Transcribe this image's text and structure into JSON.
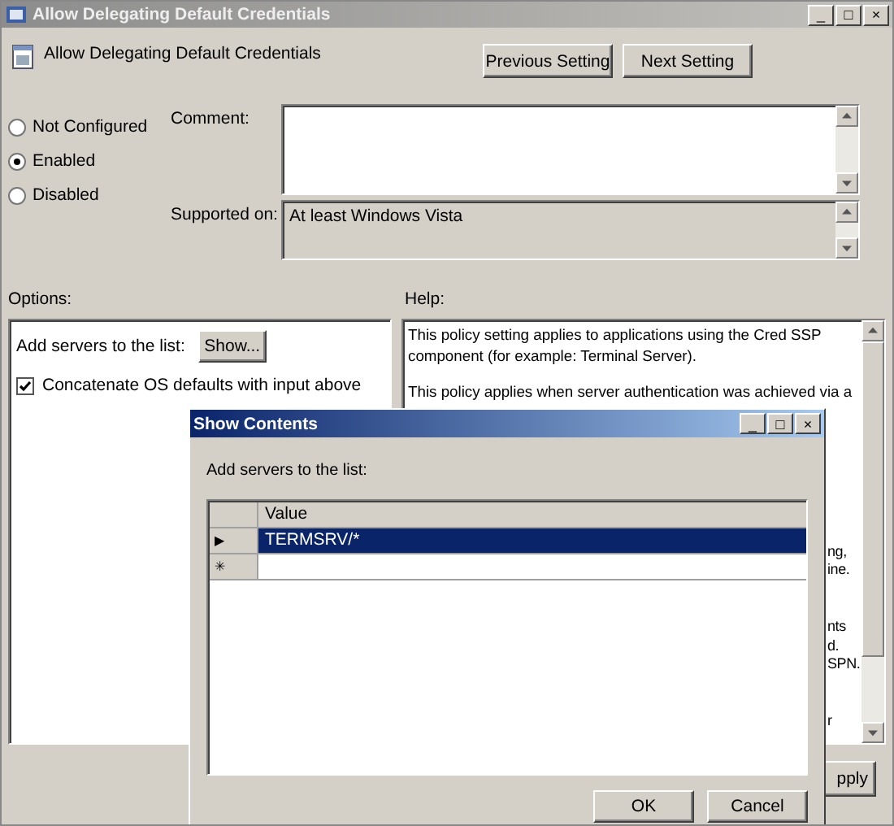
{
  "window": {
    "title": "Allow Delegating Default Credentials",
    "controls": [
      "_",
      "□",
      "×"
    ]
  },
  "setting_title": "Allow Delegating Default Credentials",
  "nav_buttons": [
    "Previous Setting",
    "Next Setting"
  ],
  "state_options": [
    {
      "label": "Not Configured",
      "selected": false
    },
    {
      "label": "Enabled",
      "selected": true
    },
    {
      "label": "Disabled",
      "selected": false
    }
  ],
  "comment": {
    "label": "Comment:"
  },
  "supported_on": {
    "label": "Supported on:",
    "value": "At least Windows Vista"
  },
  "options": {
    "label": "Options:",
    "list_label": "Add servers to the list:",
    "show_button": "Show...",
    "concatenate": {
      "label": "Concatenate OS defaults with input above",
      "checked": true
    }
  },
  "help": {
    "label": "Help:",
    "paragraphs": [
      [
        "This policy setting applies to applications using the Cred SSP",
        "component (for example: Terminal Server)."
      ],
      [
        "This policy applies when server authentication was achieved via a"
      ]
    ],
    "fragment_groups": [
      [
        "ng,",
        "ine."
      ],
      [
        "nts",
        "d.",
        "SPN."
      ],
      [
        "r"
      ]
    ]
  },
  "apply_button": "pply",
  "dialog": {
    "title": "Show Contents",
    "controls": [
      "_",
      "□",
      "×"
    ],
    "label": "Add servers to the list:",
    "column": "Value",
    "rows": [
      {
        "marker": "▶",
        "value": "TERMSRV/*",
        "selected": true
      },
      {
        "marker": "✳",
        "value": "",
        "selected": false
      }
    ],
    "buttons": [
      "OK",
      "Cancel"
    ]
  }
}
